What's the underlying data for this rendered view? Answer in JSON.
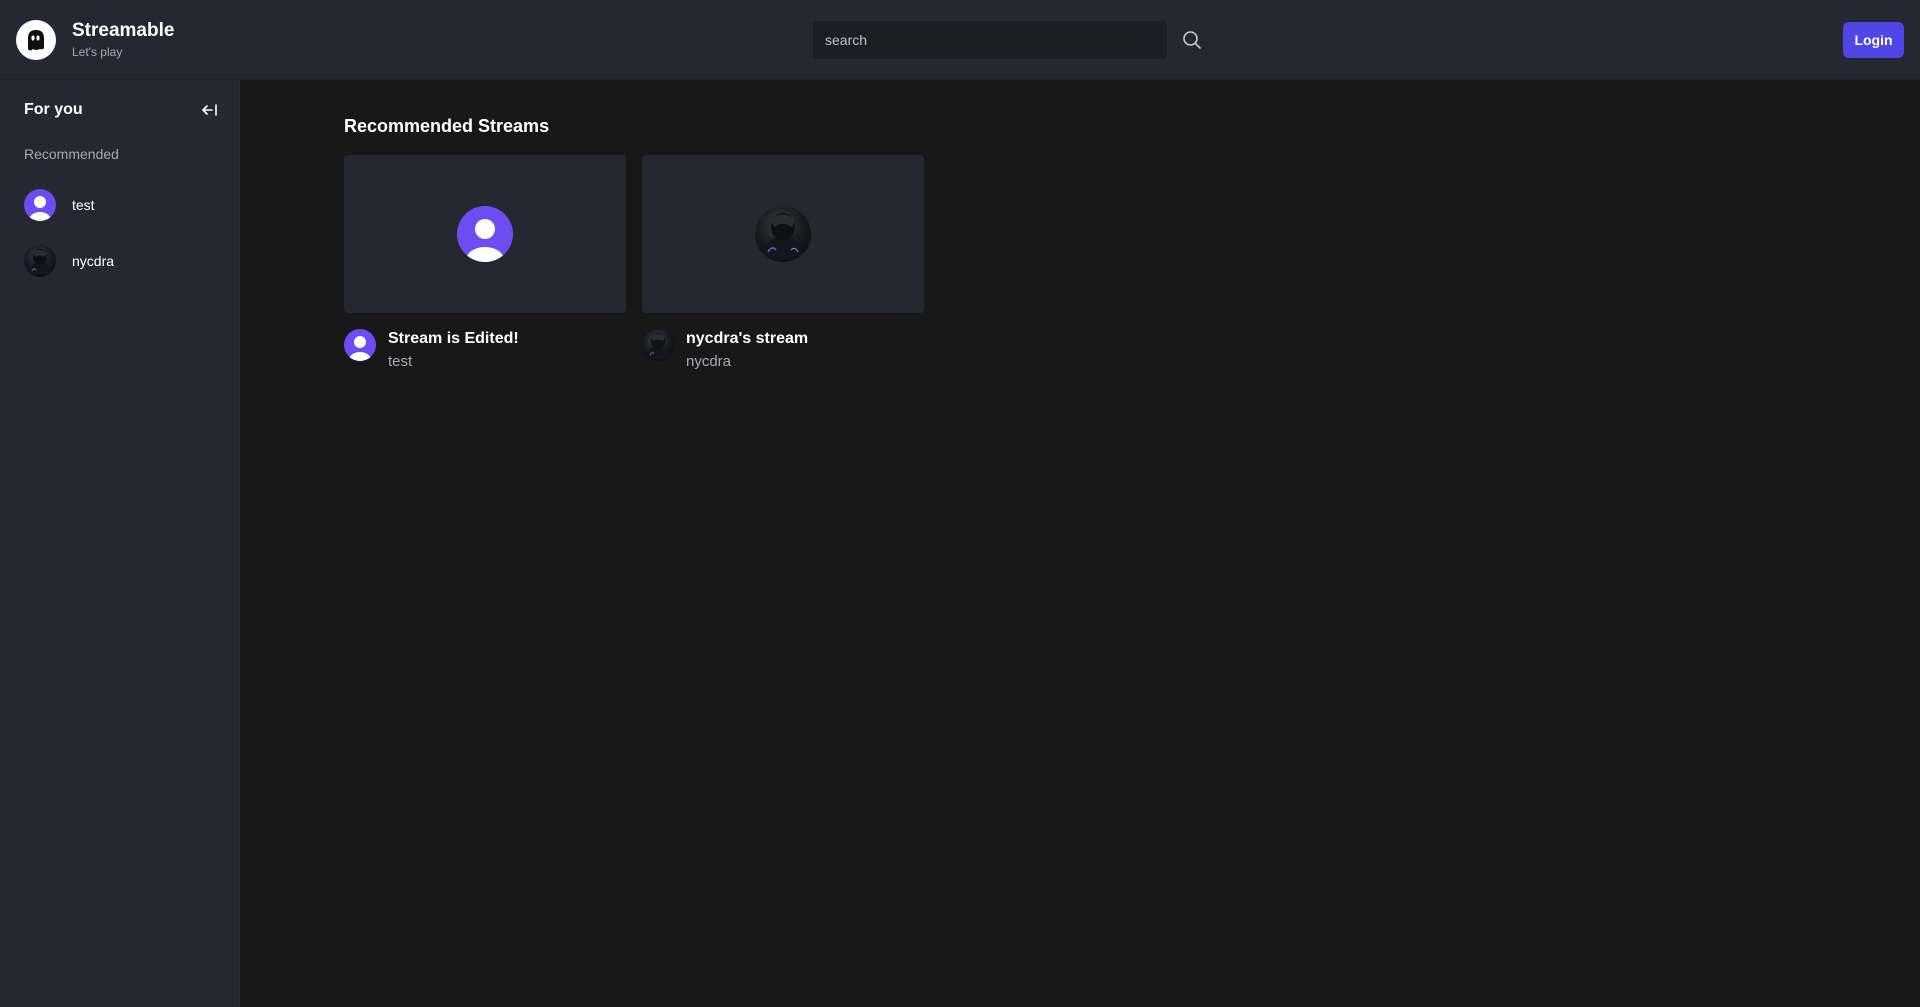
{
  "app": {
    "name": "Streamable",
    "tagline": "Let's play"
  },
  "search": {
    "placeholder": "search",
    "value": ""
  },
  "header": {
    "login_label": "Login"
  },
  "colors": {
    "accent": "#4f46e5",
    "avatar_default": "#6d4df2",
    "background": "#181818",
    "panel": "#252731"
  },
  "sidebar": {
    "title": "For you",
    "section_label": "Recommended",
    "items": [
      {
        "label": "test",
        "avatar": "default-user-avatar"
      },
      {
        "label": "nycdra",
        "avatar": "dark-portrait-avatar"
      }
    ]
  },
  "main": {
    "heading": "Recommended Streams",
    "streams": [
      {
        "title": "Stream is Edited!",
        "user": "test",
        "avatar": "default-user-avatar"
      },
      {
        "title": "nycdra's stream",
        "user": "nycdra",
        "avatar": "dark-portrait-avatar"
      }
    ]
  }
}
